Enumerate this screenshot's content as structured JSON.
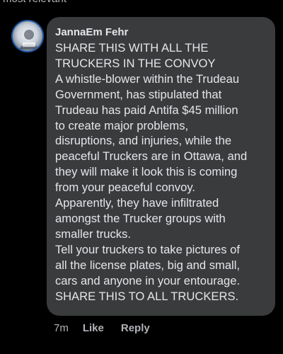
{
  "top_partial_text": "most relevant",
  "comment": {
    "author": "JannaEm Fehr",
    "lines": [
      "SHARE THIS WITH ALL THE",
      "TRUCKERS IN THE CONVOY",
      "A whistle-blower within the Trudeau",
      "Government, has stipulated that",
      "Trudeau has paid Antifa $45 million",
      "to create major problems,",
      "disruptions, and injuries, while the",
      "peaceful Truckers are in Ottawa, and",
      "they will make it look this is coming",
      "from your peaceful convoy.",
      "Apparently, they have infiltrated",
      "amongst the Trucker groups with",
      "smaller trucks.",
      "Tell your truckers to take pictures of",
      "all the license plates, big and small,",
      "cars and anyone in your entourage.",
      "SHARE THIS TO ALL TRUCKERS."
    ],
    "time": "7m",
    "like_label": "Like",
    "reply_label": "Reply",
    "avatar_icon": "profile-picture-icon"
  },
  "colors": {
    "background": "#000000",
    "bubble": "#3a3b3c",
    "text": "#e4e6eb",
    "secondary_text": "#b0b3b8"
  }
}
